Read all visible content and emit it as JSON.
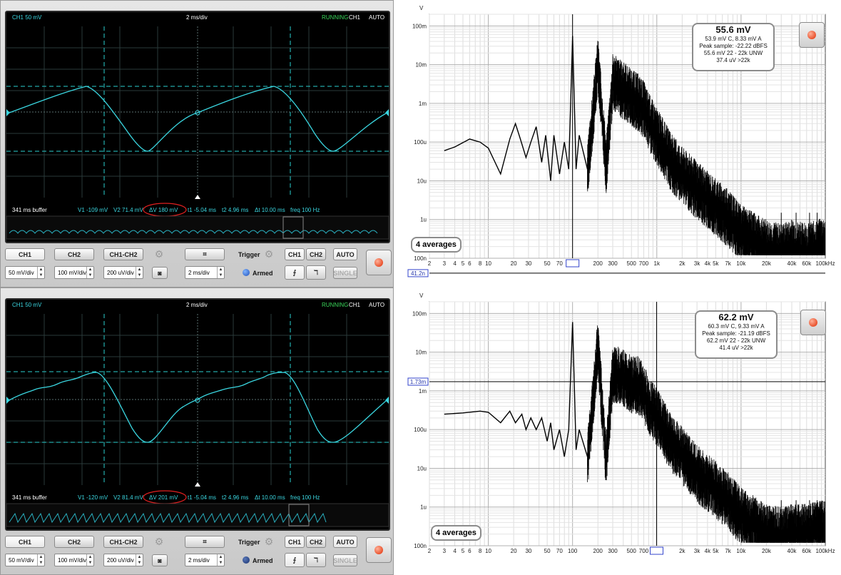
{
  "panels": [
    {
      "scope": {
        "channel_label": "CH1 50 mV",
        "timebase": "2 ms/div",
        "status": "RUNNING",
        "trigger_info": "CH1",
        "mode": "AUTO",
        "buffer": "341 ms buffer",
        "v1": "V1 -109 mV",
        "v2": "V2 71.4 mV",
        "dv": "ΔV 180 mV",
        "t1": "t1 -5.04 ms",
        "t2": "t2 4.96 ms",
        "dt": "Δt 10.00 ms",
        "freq": "freq 100 Hz"
      },
      "controls": {
        "ch1": "CH1",
        "ch2": "CH2",
        "ch1ch2": "CH1-CH2",
        "ch1_div": "50 mV/div",
        "ch2_div": "100 mV/div",
        "math_div": "200 uV/div",
        "time_div": "2 ms/div",
        "trigger_label": "Trigger",
        "armed": "Armed",
        "trig_ch1": "CH1",
        "trig_ch2": "CH2",
        "auto": "AUTO",
        "single": "SINGLE"
      },
      "spectrum": {
        "unit": "V",
        "readout_main": "55.6 mV",
        "readout_lines": [
          "53.9 mV C, 8.33 mV A",
          "Peak sample: -22.22 dBFS",
          "55.6 mV 22 - 22k UNW",
          "37.4 uV >22k"
        ],
        "averages": "4 averages",
        "cursor_level": "41.2n",
        "cursor_freq": "100",
        "y_labels": [
          "100m",
          "10m",
          "1m",
          "100u",
          "10u",
          "1u",
          "100n"
        ],
        "x_labels": [
          "2",
          "3",
          "4",
          "5",
          "6",
          "8",
          "10",
          "20",
          "30",
          "50",
          "70",
          "100",
          "200",
          "300",
          "500",
          "700",
          "1k",
          "2k",
          "3k",
          "4k",
          "5k",
          "7k",
          "10k",
          "20k",
          "40k",
          "60k",
          "100kHz"
        ],
        "chart_data": {
          "type": "line",
          "title": "",
          "xlabel": "",
          "ylabel": "V",
          "x_scale": "log",
          "y_scale": "log",
          "xlim": [
            2,
            100000
          ],
          "ylim": [
            1e-07,
            0.2
          ],
          "series": [
            {
              "values": [
                [
                  3,
                  6e-05
                ],
                [
                  4,
                  7.5e-05
                ],
                [
                  6,
                  0.00012
                ],
                [
                  8,
                  0.0001
                ],
                [
                  10,
                  7e-05
                ],
                [
                  14,
                  1.5e-05
                ],
                [
                  18,
                  0.00012
                ],
                [
                  21,
                  0.0003
                ],
                [
                  24,
                  0.00012
                ],
                [
                  28,
                  4e-05
                ],
                [
                  32,
                  0.0001
                ],
                [
                  37,
                  0.00025
                ],
                [
                  43,
                  3e-05
                ],
                [
                  48,
                  0.00015
                ],
                [
                  55,
                  1e-05
                ],
                [
                  60,
                  0.00015
                ],
                [
                  70,
                  1.5e-05
                ],
                [
                  80,
                  0.0001
                ],
                [
                  90,
                  2e-05
                ],
                [
                  100,
                  0.055
                ],
                [
                  110,
                  2e-05
                ],
                [
                  120,
                  0.00015
                ],
                [
                  150,
                  2e-05
                ],
                [
                  200,
                  0.015
                ],
                [
                  250,
                  3e-05
                ],
                [
                  300,
                  0.005
                ],
                [
                  400,
                  0.003
                ],
                [
                  500,
                  0.002
                ],
                [
                  600,
                  0.0015
                ],
                [
                  700,
                  0.001
                ],
                [
                  800,
                  0.0005
                ],
                [
                  1000,
                  0.0002
                ],
                [
                  1500,
                  4e-05
                ],
                [
                  2000,
                  2e-05
                ],
                [
                  3000,
                  8e-06
                ],
                [
                  5000,
                  3e-06
                ],
                [
                  7000,
                  1.5e-06
                ],
                [
                  10000,
                  6e-07
                ],
                [
                  20000,
                  2.5e-07
                ],
                [
                  30000,
                  2e-07
                ],
                [
                  40000,
                  2.5e-07
                ],
                [
                  60000,
                  2e-07
                ],
                [
                  100000,
                  3e-07
                ]
              ]
            }
          ]
        }
      }
    },
    {
      "scope": {
        "channel_label": "CH1 50 mV",
        "timebase": "2 ms/div",
        "status": "RUNNING",
        "trigger_info": "CH1",
        "mode": "AUTO",
        "buffer": "341 ms buffer",
        "v1": "V1 -120 mV",
        "v2": "V2 81.4 mV",
        "dv": "ΔV 201 mV",
        "t1": "t1 -5.04 ms",
        "t2": "t2 4.96 ms",
        "dt": "Δt 10.00 ms",
        "freq": "freq 100 Hz"
      },
      "controls": {
        "ch1": "CH1",
        "ch2": "CH2",
        "ch1ch2": "CH1-CH2",
        "ch1_div": "50 mV/div",
        "ch2_div": "100 mV/div",
        "math_div": "200 uV/div",
        "time_div": "2 ms/div",
        "trigger_label": "Trigger",
        "armed": "Armed",
        "trig_ch1": "CH1",
        "trig_ch2": "CH2",
        "auto": "AUTO",
        "single": "SINGLE"
      },
      "spectrum": {
        "unit": "V",
        "readout_main": "62.2 mV",
        "readout_lines": [
          "60.3 mV C, 9.33 mV A",
          "Peak sample: -21.19 dBFS",
          "62.2 mV 22 - 22k UNW",
          "41.4 uV >22k"
        ],
        "averages": "4 averages",
        "cursor_level": "1.73m",
        "cursor_freq": "994",
        "y_labels": [
          "100m",
          "10m",
          "1m",
          "100u",
          "10u",
          "1u",
          "100n"
        ],
        "x_labels": [
          "2",
          "3",
          "4",
          "5",
          "6",
          "8",
          "10",
          "20",
          "30",
          "50",
          "70",
          "100",
          "200",
          "300",
          "500",
          "700",
          "994",
          "2k",
          "3k",
          "4k",
          "5k",
          "7k",
          "10k",
          "20k",
          "40k",
          "60k",
          "100kHz"
        ],
        "chart_data": {
          "type": "line",
          "title": "",
          "xlabel": "",
          "ylabel": "V",
          "x_scale": "log",
          "y_scale": "log",
          "xlim": [
            2,
            100000
          ],
          "ylim": [
            1e-07,
            0.2
          ],
          "series": [
            {
              "values": [
                [
                  3,
                  0.00025
                ],
                [
                  5,
                  0.00027
                ],
                [
                  8,
                  0.0003
                ],
                [
                  10,
                  0.00028
                ],
                [
                  14,
                  0.00015
                ],
                [
                  18,
                  0.0003
                ],
                [
                  21,
                  0.00015
                ],
                [
                  25,
                  0.00025
                ],
                [
                  28,
                  0.0001
                ],
                [
                  32,
                  0.0002
                ],
                [
                  37,
                  0.0001
                ],
                [
                  43,
                  0.0002
                ],
                [
                  50,
                  5e-05
                ],
                [
                  55,
                  0.00015
                ],
                [
                  60,
                  3e-05
                ],
                [
                  70,
                  0.0001
                ],
                [
                  80,
                  2e-05
                ],
                [
                  90,
                  0.0001
                ],
                [
                  100,
                  0.06
                ],
                [
                  110,
                  3e-05
                ],
                [
                  120,
                  0.0001
                ],
                [
                  150,
                  2e-05
                ],
                [
                  200,
                  0.02
                ],
                [
                  250,
                  2e-05
                ],
                [
                  300,
                  0.004
                ],
                [
                  400,
                  0.003
                ],
                [
                  500,
                  0.002
                ],
                [
                  600,
                  0.002
                ],
                [
                  700,
                  0.0012
                ],
                [
                  800,
                  0.0006
                ],
                [
                  1000,
                  0.0003
                ],
                [
                  1500,
                  6e-05
                ],
                [
                  2000,
                  3e-05
                ],
                [
                  3000,
                  1e-05
                ],
                [
                  5000,
                  4e-06
                ],
                [
                  7000,
                  2e-06
                ],
                [
                  10000,
                  8e-07
                ],
                [
                  20000,
                  3e-07
                ],
                [
                  30000,
                  2.5e-07
                ],
                [
                  40000,
                  3e-07
                ],
                [
                  60000,
                  3e-07
                ],
                [
                  100000,
                  4e-07
                ]
              ]
            }
          ]
        }
      }
    }
  ]
}
